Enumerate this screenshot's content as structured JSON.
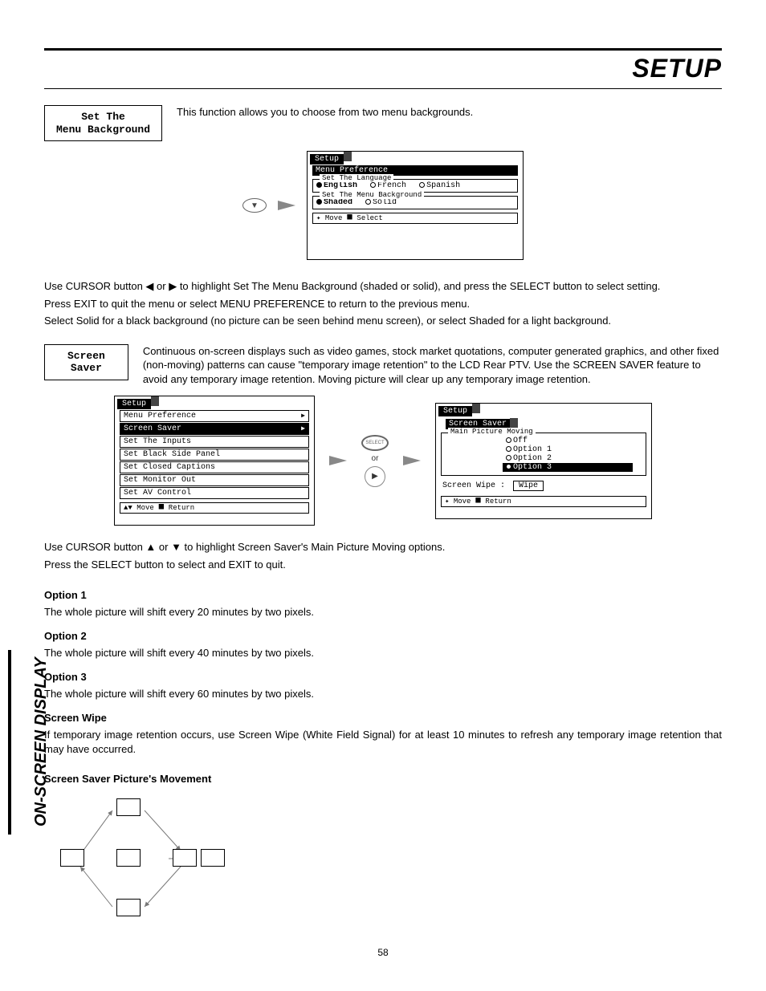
{
  "header": {
    "title": "SETUP"
  },
  "side_label": "ON-SCREEN DISPLAY",
  "page_number": "58",
  "section1": {
    "box_label": "Set The\nMenu Background",
    "desc": "This function allows you to choose from two menu backgrounds.",
    "osd": {
      "setup": "Setup",
      "menu_pref": "Menu Preference",
      "lang_legend": "Set The Language",
      "lang_opts": [
        "English",
        "French",
        "Spanish"
      ],
      "bg_legend": "Set The Menu Background",
      "bg_opts": [
        "Shaded",
        "Solid"
      ],
      "footer": "✦ Move  ⯀ Select"
    },
    "p1": "Use CURSOR button ◀ or ▶ to highlight Set The Menu Background (shaded or solid), and press the SELECT button to select setting.",
    "p2": "Press EXIT to quit the menu or select MENU PREFERENCE to return to the previous menu.",
    "p3": "Select Solid for a black background (no picture can be seen behind menu screen), or select Shaded for a light background."
  },
  "section2": {
    "box_label": "Screen\nSaver",
    "desc": "Continuous on-screen displays such as video games, stock market quotations, computer generated graphics, and other fixed (non-moving) patterns can cause \"temporary image retention\" to the LCD Rear PTV.  Use the SCREEN SAVER feature to avoid any temporary image retention.  Moving picture will clear up any temporary image retention.",
    "osd_left": {
      "setup": "Setup",
      "items": [
        "Menu Preference",
        "Screen Saver",
        "Set The Inputs",
        "Set Black Side Panel",
        "Set Closed Captions",
        "Set Monitor Out",
        "Set AV Control"
      ],
      "footer": "▲▼ Move  ⯀ Return"
    },
    "middle": {
      "select": "SELECT",
      "or": "or"
    },
    "osd_right": {
      "setup": "Setup",
      "screen_saver": "Screen Saver",
      "mpm_legend": "Main Picture Moving",
      "opts": [
        "Off",
        "Option 1",
        "Option 2",
        "Option 3"
      ],
      "wipe_label": "Screen Wipe :",
      "wipe_value": "Wipe",
      "footer": "✦ Move  ⯀ Return"
    },
    "p1": "Use CURSOR button ▲ or ▼ to highlight Screen Saver's Main Picture Moving options.",
    "p2": "Press the SELECT button to select and EXIT to quit.",
    "opt1_h": "Option 1",
    "opt1_t": "The whole picture will shift every 20 minutes by two pixels.",
    "opt2_h": "Option 2",
    "opt2_t": "The whole picture will shift every 40 minutes by two pixels.",
    "opt3_h": "Option 3",
    "opt3_t": "The whole picture will shift every 60 minutes by two pixels.",
    "wipe_h": "Screen Wipe",
    "wipe_t": "If temporary image retention occurs, use Screen Wipe (White Field Signal) for at least 10 minutes to refresh any temporary image retention that may have occurred.",
    "movement_h": "Screen Saver Picture's Movement"
  }
}
